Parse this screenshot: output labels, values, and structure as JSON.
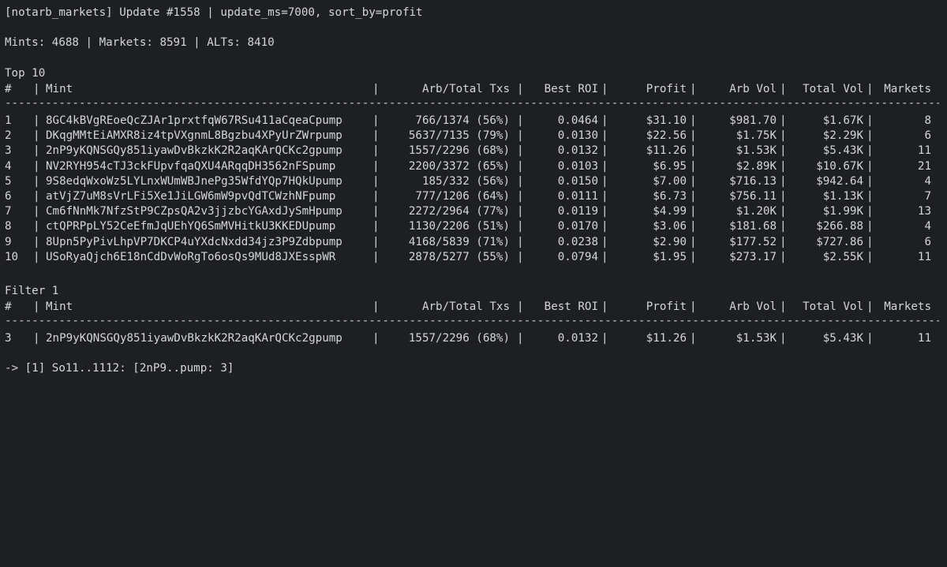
{
  "header": "[notarb_markets] Update #1558 | update_ms=7000, sort_by=profit",
  "stats_line": "Mints: 4688 | Markets: 8591 | ALTs: 8410",
  "separator": "---------------------------------------------------------------------------------------------------------------------------------------------------------------",
  "columns": {
    "rank": "#",
    "mint": "Mint",
    "arb_txs": "Arb/Total Txs",
    "best_roi": "Best ROI",
    "profit": "Profit",
    "arb_vol": "Arb Vol",
    "total_vol": "Total Vol",
    "markets": "Markets"
  },
  "top10": {
    "title": "Top 10",
    "rows": [
      {
        "rank": "1",
        "mint": "8GC4kBVgREoeQcZJAr1prxtfqW67RSu411aCqeaCpump",
        "arb_txs": "766/1374 (56%)",
        "best_roi": "0.0464",
        "profit": "$31.10",
        "arb_vol": "$981.70",
        "total_vol": "$1.67K",
        "markets": "8"
      },
      {
        "rank": "2",
        "mint": "DKqgMMtEiAMXR8iz4tpVXgnmL8Bgzbu4XPyUrZWrpump",
        "arb_txs": "5637/7135 (79%)",
        "best_roi": "0.0130",
        "profit": "$22.56",
        "arb_vol": "$1.75K",
        "total_vol": "$2.29K",
        "markets": "6"
      },
      {
        "rank": "3",
        "mint": "2nP9yKQNSGQy851iyawDvBkzkK2R2aqKArQCKc2gpump",
        "arb_txs": "1557/2296 (68%)",
        "best_roi": "0.0132",
        "profit": "$11.26",
        "arb_vol": "$1.53K",
        "total_vol": "$5.43K",
        "markets": "11"
      },
      {
        "rank": "4",
        "mint": "NV2RYH954cTJ3ckFUpvfqaQXU4ARqqDH3562nFSpump",
        "arb_txs": "2200/3372 (65%)",
        "best_roi": "0.0103",
        "profit": "$6.95",
        "arb_vol": "$2.89K",
        "total_vol": "$10.67K",
        "markets": "21"
      },
      {
        "rank": "5",
        "mint": "9S8edqWxoWz5LYLnxWUmWBJnePg35WfdYQp7HQkUpump",
        "arb_txs": "185/332 (56%)",
        "best_roi": "0.0150",
        "profit": "$7.00",
        "arb_vol": "$716.13",
        "total_vol": "$942.64",
        "markets": "4"
      },
      {
        "rank": "6",
        "mint": "atVjZ7uM8sVrLFi5Xe1JiLGW6mW9pvQdTCWzhNFpump",
        "arb_txs": "777/1206 (64%)",
        "best_roi": "0.0111",
        "profit": "$6.73",
        "arb_vol": "$756.11",
        "total_vol": "$1.13K",
        "markets": "7"
      },
      {
        "rank": "7",
        "mint": "Cm6fNnMk7NfzStP9CZpsQA2v3jjzbcYGAxdJySmHpump",
        "arb_txs": "2272/2964 (77%)",
        "best_roi": "0.0119",
        "profit": "$4.99",
        "arb_vol": "$1.20K",
        "total_vol": "$1.99K",
        "markets": "13"
      },
      {
        "rank": "8",
        "mint": "ctQPRPpLY52CeEfmJqUEhYQ6SmMVHitkU3KKEDUpump",
        "arb_txs": "1130/2206 (51%)",
        "best_roi": "0.0170",
        "profit": "$3.06",
        "arb_vol": "$181.68",
        "total_vol": "$266.88",
        "markets": "4"
      },
      {
        "rank": "9",
        "mint": "8Upn5PyPivLhpVP7DKCP4uYXdcNxdd34jz3P9Zdbpump",
        "arb_txs": "4168/5839 (71%)",
        "best_roi": "0.0238",
        "profit": "$2.90",
        "arb_vol": "$177.52",
        "total_vol": "$727.86",
        "markets": "6"
      },
      {
        "rank": "10",
        "mint": "USoRyaQjch6E18nCdDvWoRgTo6osQs9MUd8JXEsspWR",
        "arb_txs": "2878/5277 (55%)",
        "best_roi": "0.0794",
        "profit": "$1.95",
        "arb_vol": "$273.17",
        "total_vol": "$2.55K",
        "markets": "11"
      }
    ]
  },
  "filter1": {
    "title": "Filter 1",
    "rows": [
      {
        "rank": "3",
        "mint": "2nP9yKQNSGQy851iyawDvBkzkK2R2aqKArQCKc2gpump",
        "arb_txs": "1557/2296 (68%)",
        "best_roi": "0.0132",
        "profit": "$11.26",
        "arb_vol": "$1.53K",
        "total_vol": "$5.43K",
        "markets": "11"
      }
    ]
  },
  "route_line": "-> [1] So11..1112: [2nP9..pump: 3]",
  "colors": {
    "background": "#1e1f22",
    "foreground": "#d4d6da"
  }
}
